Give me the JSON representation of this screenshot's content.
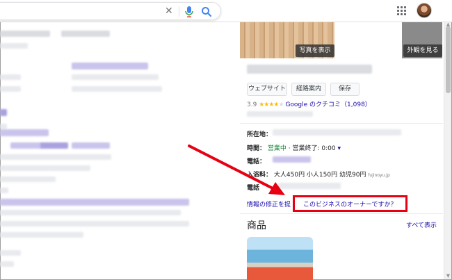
{
  "search": {
    "value": "",
    "placeholder": ""
  },
  "panel": {
    "photo_button": "写真を表示",
    "exterior_button": "外観を見る",
    "buttons": {
      "website": "ウェブサイト",
      "directions": "経路案内",
      "save": "保存"
    },
    "rating": {
      "score": "3.9",
      "stars_filled": 4,
      "reviews_link": "Google のクチコミ（1,098）"
    },
    "address_label": "所在地：",
    "hours_label": "時間：",
    "hours_status": "営業中",
    "hours_close": "· 営業終了: 0:00",
    "phone_label": "電話：",
    "fee_label": "入浴料：",
    "fee_value": "大人450円 小人150円 幼児90円",
    "fee_source": "fujinoyu.jp",
    "phone2_label": "電話",
    "suggest_edit": "情報の修正を提",
    "owner_question": "このビジネスのオーナーですか？",
    "products_title": "商品",
    "see_all": "すべて表示"
  },
  "colors": {
    "highlight": "#e60012",
    "link": "#1a0dab",
    "open": "#188038",
    "star": "#fbbc04"
  }
}
